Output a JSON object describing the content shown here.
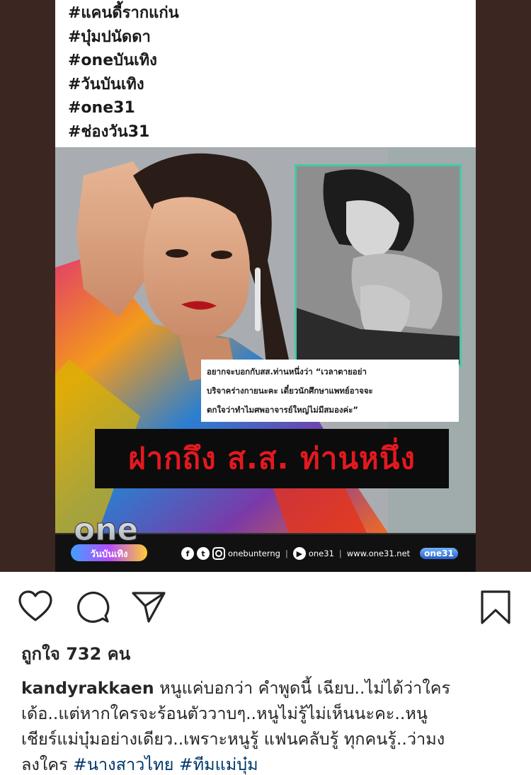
{
  "post_image": {
    "hashtags": [
      "#แคนดี้รากแก่น",
      "#บุ๋มปนัดดา",
      "#oneบันเทิง",
      "#วันบันเทิง",
      "#one31",
      "#ช่องวัน31"
    ],
    "quote_lines": [
      "อยากจะบอกกับสส.ท่านหนึ่งว่า “เวลาตายอย่า",
      "บริจาคร่างกายนะคะ เดี๋ยวนักศึกษาแพทย์อาจจะ",
      "ตกใจว่าทำไมศพอาจารย์ใหญ่ไม่มีสมองค่ะ”"
    ],
    "headline": "ฝากถึง ส.ส. ท่านหนึ่ง",
    "logo_text": "one",
    "logo_subtext": "วันบันเทิง",
    "footer": {
      "social_handle": "onebunterng",
      "channel_handle": "one31",
      "website": "www.one31.net",
      "badge": "one31"
    }
  },
  "actions": {
    "like_icon": "heart-outline-icon",
    "comment_icon": "comment-bubble-icon",
    "share_icon": "send-paper-plane-icon",
    "save_icon": "bookmark-outline-icon"
  },
  "likes_text": "ถูกใจ 732 คน",
  "caption": {
    "username": "kandyrakkaen",
    "line1": " หนูแค่บอกว่า คำพูดนี้ เฉียบ..ไม่ได้ว่าใคร",
    "line2": "เด้อ..แต่หากใครจะร้อนตัววาบๆ..หนูไม่รู้ไม่เห็นนะคะ..หนู",
    "line3": "เชียร์แม่บุ๋มอย่างเดียว..เพราะหนูรู้ แฟนคลับรู้ ทุกคนรู้..ว่ามง",
    "line4": "ลงใคร ",
    "hashtag1": "#นางสาวไทย",
    "hashtag2": "#ทีมแม่บุ๋ม"
  },
  "colors": {
    "frame_background": "#3c2622",
    "headline_red": "#e3191f",
    "inset_border": "#45c9a8",
    "hashtag_link": "#00376b",
    "text": "#262626"
  }
}
